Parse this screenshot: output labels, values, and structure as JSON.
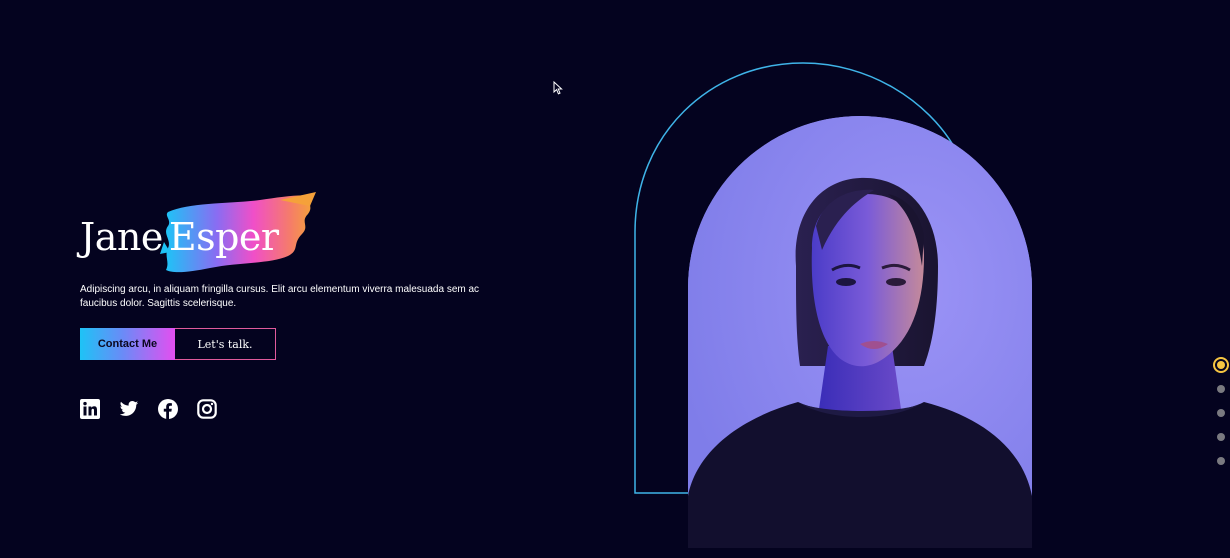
{
  "hero": {
    "first_name": "Jane",
    "last_name": "Esper",
    "tagline": "Adipiscing arcu, in aliquam fringilla cursus. Elit arcu elementum viverra malesuada sem ac faucibus dolor. Sagittis scelerisque."
  },
  "cta": {
    "contact_label": "Contact Me",
    "talk_label": "Let's talk."
  },
  "social": [
    "linkedin-icon",
    "twitter-icon",
    "facebook-icon",
    "instagram-icon"
  ],
  "slides": {
    "count": 5,
    "active_index": 0
  },
  "colors": {
    "background": "#04031f",
    "accent_cyan": "#1ec3f6",
    "accent_pink": "#e34ff0",
    "accent_orange": "#f5a13a",
    "arch_outline": "#3fb4e8",
    "active_dot": "#f5c542"
  }
}
